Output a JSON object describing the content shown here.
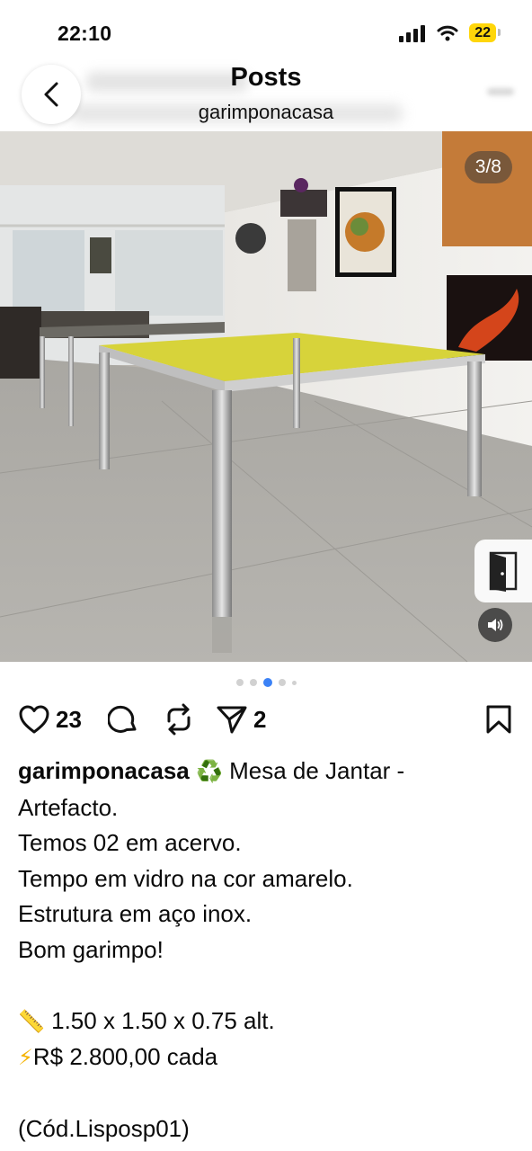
{
  "status_bar": {
    "time": "22:10",
    "battery": "22"
  },
  "header": {
    "title": "Posts",
    "subtitle": "garimponacasa"
  },
  "media": {
    "counter": "3/8"
  },
  "carousel": {
    "dot_count": 5,
    "active_index": 2
  },
  "actions": {
    "likes": "23",
    "shares": "2"
  },
  "caption": {
    "username": "garimponacasa",
    "recycle_icon": "♻️",
    "line1": "Mesa de Jantar -",
    "line2": "Artefacto.",
    "line3": "Temos 02 em acervo.",
    "line4": "Tempo em vidro na cor amarelo.",
    "line5": "Estrutura em aço inox.",
    "line6": "Bom garimpo!",
    "ruler_icon": "📏",
    "dimensions": "1.50 x 1.50 x 0.75 alt.",
    "lightning_icon": "⚡",
    "price": "R$ 2.800,00 cada",
    "code": "(Cód.Lisposp01)"
  },
  "colors": {
    "accent_dot": "#3b82f6",
    "battery": "#ffd60a",
    "recycle": "#2e9e44",
    "lightning": "#f5b301"
  }
}
